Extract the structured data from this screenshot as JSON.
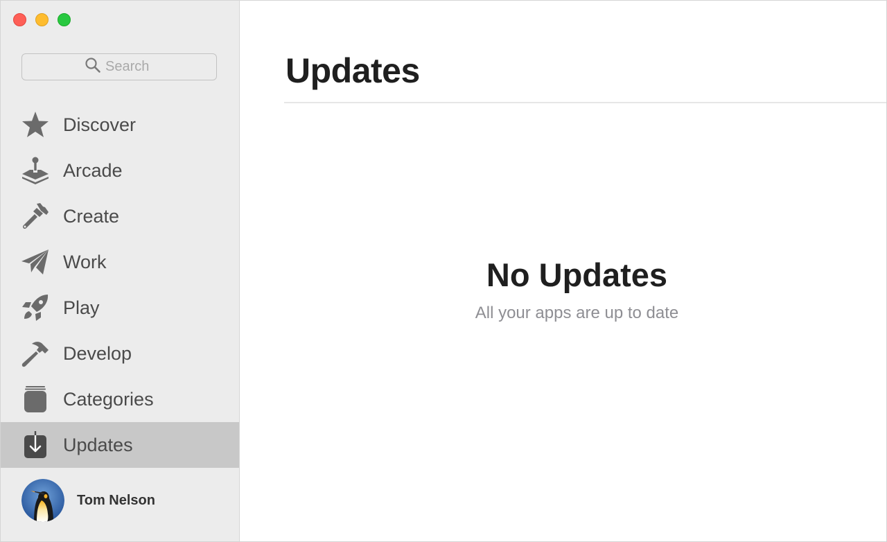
{
  "window": {
    "controls": {
      "close": "close",
      "minimize": "minimize",
      "zoom": "zoom"
    }
  },
  "sidebar": {
    "search": {
      "placeholder": "Search",
      "value": "",
      "icon": "magnifier-icon"
    },
    "items": [
      {
        "id": "discover",
        "label": "Discover",
        "icon": "star-icon",
        "active": false
      },
      {
        "id": "arcade",
        "label": "Arcade",
        "icon": "joystick-icon",
        "active": false
      },
      {
        "id": "create",
        "label": "Create",
        "icon": "paintbrush-icon",
        "active": false
      },
      {
        "id": "work",
        "label": "Work",
        "icon": "paper-plane-icon",
        "active": false
      },
      {
        "id": "play",
        "label": "Play",
        "icon": "rocket-icon",
        "active": false
      },
      {
        "id": "develop",
        "label": "Develop",
        "icon": "hammer-icon",
        "active": false
      },
      {
        "id": "categories",
        "label": "Categories",
        "icon": "stack-icon",
        "active": false
      },
      {
        "id": "updates",
        "label": "Updates",
        "icon": "download-tray-icon",
        "active": true
      }
    ],
    "account": {
      "name": "Tom Nelson",
      "avatar": "penguin-avatar"
    }
  },
  "main": {
    "title": "Updates",
    "empty_state": {
      "title": "No Updates",
      "subtitle": "All your apps are up to date"
    }
  },
  "colors": {
    "sidebar_bg": "#ececec",
    "active_item_bg": "#c8c8c8",
    "icon_gray": "#6b6b6b",
    "close": "#fe5f57",
    "minimize": "#febc2e",
    "zoom": "#28c840"
  }
}
